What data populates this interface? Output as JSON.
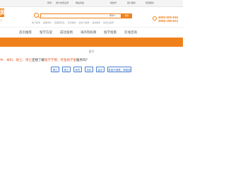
{
  "topbar": {
    "items": [
      "登录",
      "用户免费注册",
      "网站导航",
      "微信号",
      "客户服务",
      "增值服务"
    ]
  },
  "logo": {
    "text": "网",
    "sub": "上"
  },
  "search": {
    "placeholder": "",
    "type_label": "博学 ▾",
    "button_label": "搜索",
    "hotwords": [
      "热门搜索",
      "美国本科",
      "英国研究生",
      "高考留学",
      "加拿大留学",
      "澳洲留学",
      "新西兰留学"
    ]
  },
  "phones": [
    "4000-000-916",
    "4006-199-913"
  ],
  "nav": [
    "首页推荐",
    "留学方案",
    "成功案例",
    "海外院校库",
    "留学指南",
    "在线咨询"
  ],
  "content": {
    "title": "留学",
    "question_prefix": "中、本科、硕士、博士",
    "question_highlight1": "还想了解",
    "question_highlight2": "留学学费、",
    "question_rest": "奖金助学金",
    "question_end": "服务吗？",
    "options": [
      "博士",
      "硕士",
      "研究",
      "本科",
      "高中",
      "其他不清楚、帮助我"
    ]
  },
  "colors": {
    "accent": "#f08019",
    "link": "#2d6cc4"
  }
}
